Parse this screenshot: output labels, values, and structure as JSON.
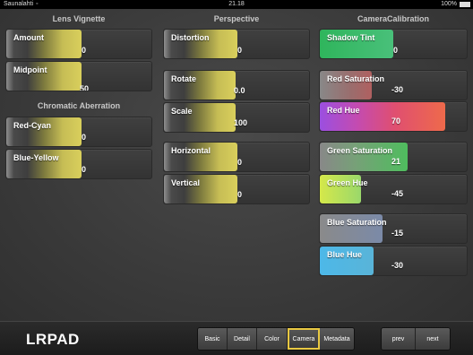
{
  "status_bar": {
    "carrier": "Saunalahti",
    "time": "21.18",
    "battery": "100%"
  },
  "columns": {
    "lens_vignette": {
      "title": "Lens Vignette",
      "sliders": [
        {
          "label": "Amount",
          "value": "0",
          "level": 0.5
        },
        {
          "label": "Midpoint",
          "value": "50",
          "level": 0.5
        }
      ]
    },
    "chromatic_aberration": {
      "title": "Chromatic Aberration",
      "sliders": [
        {
          "label": "Red-Cyan",
          "value": "0",
          "level": 0.5
        },
        {
          "label": "Blue-Yellow",
          "value": "0",
          "level": 0.5
        }
      ]
    },
    "perspective": {
      "title": "Perspective",
      "sliders": [
        {
          "label": "Distortion",
          "value": "0",
          "level": 0.5
        },
        {
          "label": "Rotate",
          "value": "0.0",
          "level": 0.5
        },
        {
          "label": "Scale",
          "value": "100",
          "level": 0.5
        },
        {
          "label": "Horizontal",
          "value": "0",
          "level": 0.5
        },
        {
          "label": "Vertical",
          "value": "0",
          "level": 0.5
        }
      ]
    },
    "camera_calibration": {
      "title": "CameraCalibration",
      "sliders": [
        {
          "label": "Shadow Tint",
          "value": "0",
          "level": 0.5,
          "color": "#2fb55c"
        },
        {
          "label": "Red Saturation",
          "value": "-30",
          "level": 0.5,
          "color": "#9a6d6d"
        },
        {
          "label": "Red Hue",
          "value": "70",
          "level": 1.0,
          "color": "#ee6a4b"
        },
        {
          "label": "Green Saturation",
          "value": "21",
          "level": 0.6,
          "color": "#4fbd5e"
        },
        {
          "label": "Green Hue",
          "value": "-45",
          "level": 0.2,
          "color": "#d5e84a"
        },
        {
          "label": "Blue Saturation",
          "value": "-15",
          "level": 0.5,
          "color": "#7b8aa8"
        },
        {
          "label": "Blue Hue",
          "value": "-30",
          "level": 0.35,
          "color": "#4db8e8"
        }
      ]
    }
  },
  "bottom_bar": {
    "logo": "LRPAD",
    "tabs": [
      "Basic",
      "Detail",
      "Color",
      "Camera",
      "Metadata"
    ],
    "active_tab": "Camera",
    "nav": [
      "prev",
      "next"
    ]
  },
  "accent_color": "#e8c842"
}
